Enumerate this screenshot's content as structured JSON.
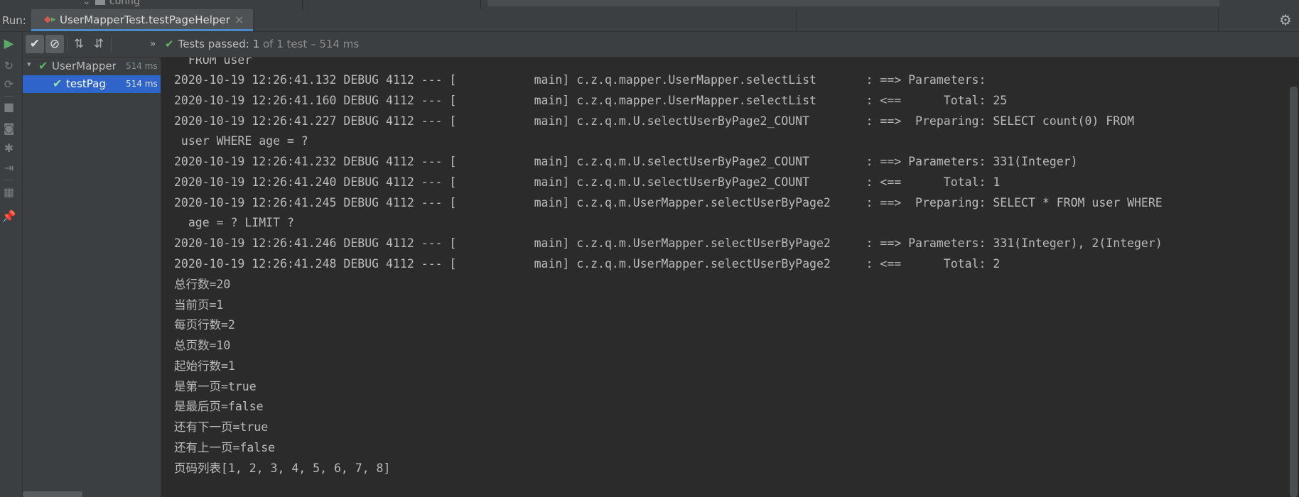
{
  "top_strip": {
    "crumb": "config"
  },
  "run_header": {
    "run_label": "Run:",
    "tab_label": "UserMapperTest.testPageHelper",
    "close_glyph": "×"
  },
  "toolbar": {
    "status_prefix": "Tests passed:",
    "status_count": "1",
    "status_rest": "of 1 test – 514 ms"
  },
  "tree": {
    "items": [
      {
        "name": "UserMapper",
        "time": "514 ms",
        "selected": false
      },
      {
        "name": "testPage",
        "time": "514 ms",
        "selected": true
      }
    ]
  },
  "console": {
    "lines": [
      "  FROM user",
      "2020-10-19 12:26:41.132 DEBUG 4112 --- [           main] c.z.q.mapper.UserMapper.selectList       : ==> Parameters: ",
      "2020-10-19 12:26:41.160 DEBUG 4112 --- [           main] c.z.q.mapper.UserMapper.selectList       : <==      Total: 25",
      "2020-10-19 12:26:41.227 DEBUG 4112 --- [           main] c.z.q.m.U.selectUserByPage2_COUNT        : ==>  Preparing: SELECT count(0) FROM",
      " user WHERE age = ?",
      "2020-10-19 12:26:41.232 DEBUG 4112 --- [           main] c.z.q.m.U.selectUserByPage2_COUNT        : ==> Parameters: 331(Integer)",
      "2020-10-19 12:26:41.240 DEBUG 4112 --- [           main] c.z.q.m.U.selectUserByPage2_COUNT        : <==      Total: 1",
      "2020-10-19 12:26:41.245 DEBUG 4112 --- [           main] c.z.q.m.UserMapper.selectUserByPage2     : ==>  Preparing: SELECT * FROM user WHERE",
      "  age = ? LIMIT ?",
      "2020-10-19 12:26:41.246 DEBUG 4112 --- [           main] c.z.q.m.UserMapper.selectUserByPage2     : ==> Parameters: 331(Integer), 2(Integer)",
      "2020-10-19 12:26:41.248 DEBUG 4112 --- [           main] c.z.q.m.UserMapper.selectUserByPage2     : <==      Total: 2",
      "总行数=20",
      "当前页=1",
      "每页行数=2",
      "总页数=10",
      "起始行数=1",
      "是第一页=true",
      "是最后页=false",
      "还有下一页=true",
      "还有上一页=false",
      "页码列表[1, 2, 3, 4, 5, 6, 7, 8]"
    ]
  },
  "icons": {
    "rerun": "play-icon",
    "show_passed": "check-icon",
    "show_ignored": "circle-slash-icon",
    "sort_alpha": "sort-alphabetical-icon",
    "sort_duration": "sort-duration-icon",
    "expand": "double-chevron-right-icon",
    "settings": "gear-icon"
  },
  "colors": {
    "accent": "#4a88c7",
    "pass": "#5fb760",
    "selection": "#2f65ca",
    "background": "#2b2b2b",
    "panel": "#3c3f41"
  }
}
